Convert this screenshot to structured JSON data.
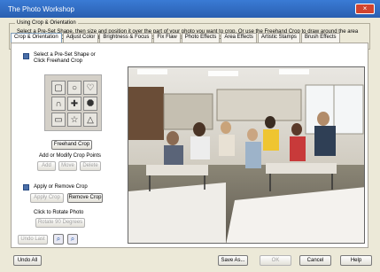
{
  "window": {
    "title": "The Photo Workshop",
    "close_label": "×"
  },
  "instructions": {
    "group_title": "Using Crop & Orientation",
    "text": "Select a Pre-Set Shape, then size and position it over the part of your photo you want to crop. Or use the Freehand Crop to draw around the area you want to keep. Click on the starting point, or double-click, to close the Freehand Crop."
  },
  "tabs": [
    {
      "label": "Crop & Orientation",
      "active": true
    },
    {
      "label": "Adjust Color"
    },
    {
      "label": "Brightness & Focus"
    },
    {
      "label": "Fix Flaw"
    },
    {
      "label": "Photo Effects"
    },
    {
      "label": "Area Effects"
    },
    {
      "label": "Artistic Stamps"
    },
    {
      "label": "Brush Effects"
    }
  ],
  "crop": {
    "select_label_1": "Select a Pre-Set Shape or",
    "select_label_2": "Click Freehand Crop",
    "shapes": [
      "square",
      "circle",
      "heart",
      "arch",
      "cross",
      "octagon",
      "rectangle",
      "star",
      "triangle"
    ],
    "freehand_button": "Freehand Crop",
    "points_label": "Add or Modify Crop Points",
    "add_button": "Add",
    "move_button": "Move",
    "delete_button": "Delete",
    "apply_remove_label": "Apply or Remove Crop",
    "apply_button": "Apply Crop",
    "remove_button": "Remove Crop",
    "rotate_label": "Click to Rotate Photo",
    "rotate_button": "Rotate 90 Degrees",
    "undo_last_button": "Undo Last"
  },
  "bottom": {
    "undo_all": "Undo All",
    "save_as": "Save As...",
    "ok": "OK",
    "cancel": "Cancel",
    "help": "Help"
  },
  "colors": {
    "title_bar": "#2a5fb0",
    "accent": "#4b6fa8"
  }
}
